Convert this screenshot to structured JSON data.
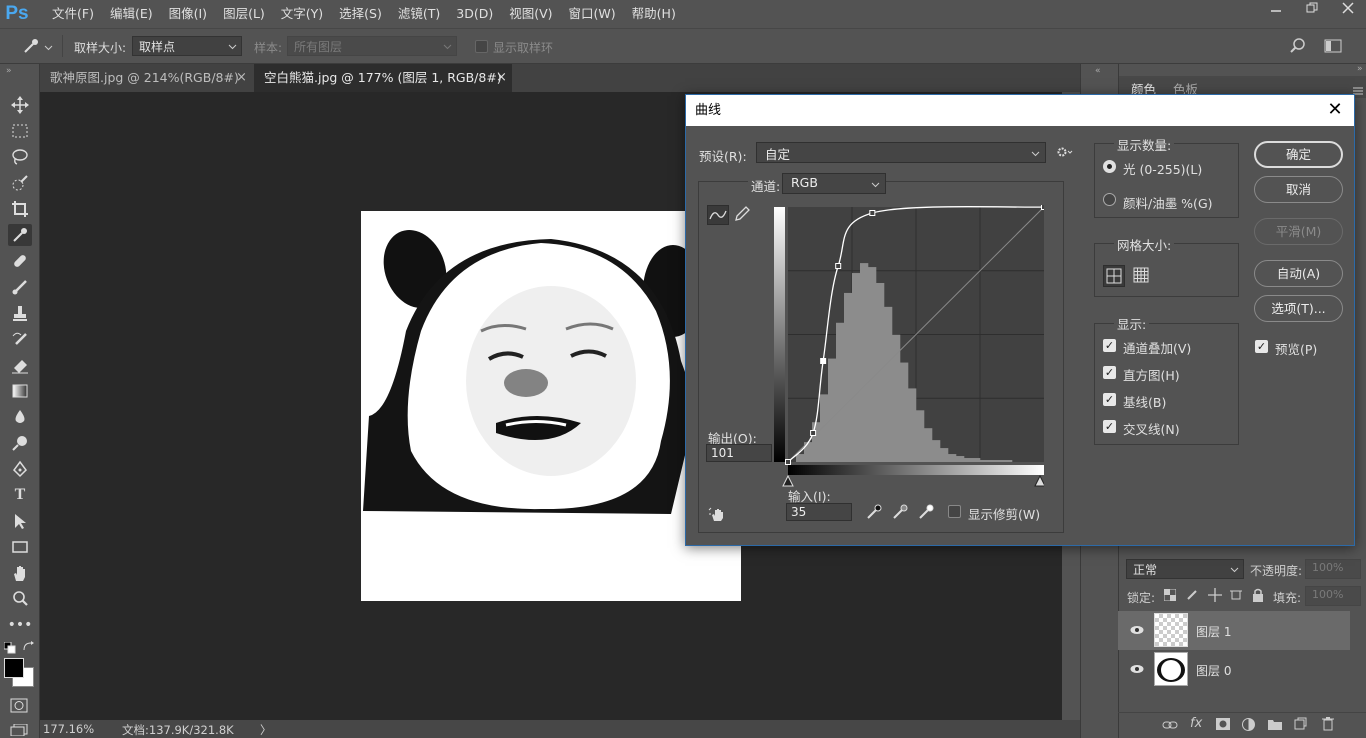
{
  "app": {
    "logo": "Ps"
  },
  "menu": [
    "文件(F)",
    "编辑(E)",
    "图像(I)",
    "图层(L)",
    "文字(Y)",
    "选择(S)",
    "滤镜(T)",
    "3D(D)",
    "视图(V)",
    "窗口(W)",
    "帮助(H)"
  ],
  "options": {
    "sample_size_label": "取样大小:",
    "sample_size_value": "取样点",
    "sample_label": "样本:",
    "sample_value": "所有图层",
    "show_ring_label": "显示取样环"
  },
  "tabs": [
    {
      "label": "歌神原图.jpg @ 214%(RGB/8#) *",
      "close": "×"
    },
    {
      "label": "空白熊猫.jpg @ 177% (图层 1, RGB/8#) *",
      "close": "×"
    }
  ],
  "status": {
    "zoom": "177.16%",
    "doc": "文档:137.9K/321.8K",
    "arrow": "〉"
  },
  "right_panel": {
    "tab1": "颜色",
    "tab2": "色板"
  },
  "layers_panel": {
    "blend_mode": "正常",
    "opacity_label": "不透明度:",
    "opacity_value": "100%",
    "lock_label": "锁定:",
    "fill_label": "填充:",
    "fill_value": "100%",
    "layers": [
      {
        "name": "图层 1",
        "selected": true
      },
      {
        "name": "图层 0",
        "selected": false
      }
    ]
  },
  "dialog": {
    "title": "曲线",
    "close": "✕",
    "preset_label": "预设(R):",
    "preset_value": "自定",
    "channel_label": "通道:",
    "channel_value": "RGB",
    "output_label": "输出(O):",
    "output_value": "101",
    "input_label": "输入(I):",
    "input_value": "35",
    "show_clipping_label": "显示修剪(W)",
    "display_amount_title": "显示数量:",
    "light_option": "光 (0-255)(L)",
    "pigment_option": "颜料/油墨 %(G)",
    "grid_size_title": "网格大小:",
    "show_title": "显示:",
    "show_options": [
      "通道叠加(V)",
      "直方图(H)",
      "基线(B)",
      "交叉线(N)"
    ],
    "buttons": {
      "ok": "确定",
      "cancel": "取消",
      "smooth": "平滑(M)",
      "auto": "自动(A)",
      "options": "选项(T)..."
    },
    "preview_label": "预览(P)"
  },
  "chart_data": {
    "type": "line",
    "title": "",
    "xlim": [
      0,
      255
    ],
    "ylim": [
      0,
      255
    ],
    "grid": "4x4",
    "points": [
      [
        0,
        0
      ],
      [
        25,
        29
      ],
      [
        35,
        101
      ],
      [
        50,
        196
      ],
      [
        84,
        249
      ],
      [
        255,
        255
      ]
    ],
    "histogram_levels": [
      0,
      4,
      10,
      20,
      34,
      52,
      70,
      85,
      95,
      100,
      98,
      90,
      78,
      64,
      50,
      37,
      26,
      17,
      11,
      7,
      4,
      3,
      2,
      2,
      1,
      1,
      1,
      1,
      0,
      0,
      0,
      0
    ]
  }
}
